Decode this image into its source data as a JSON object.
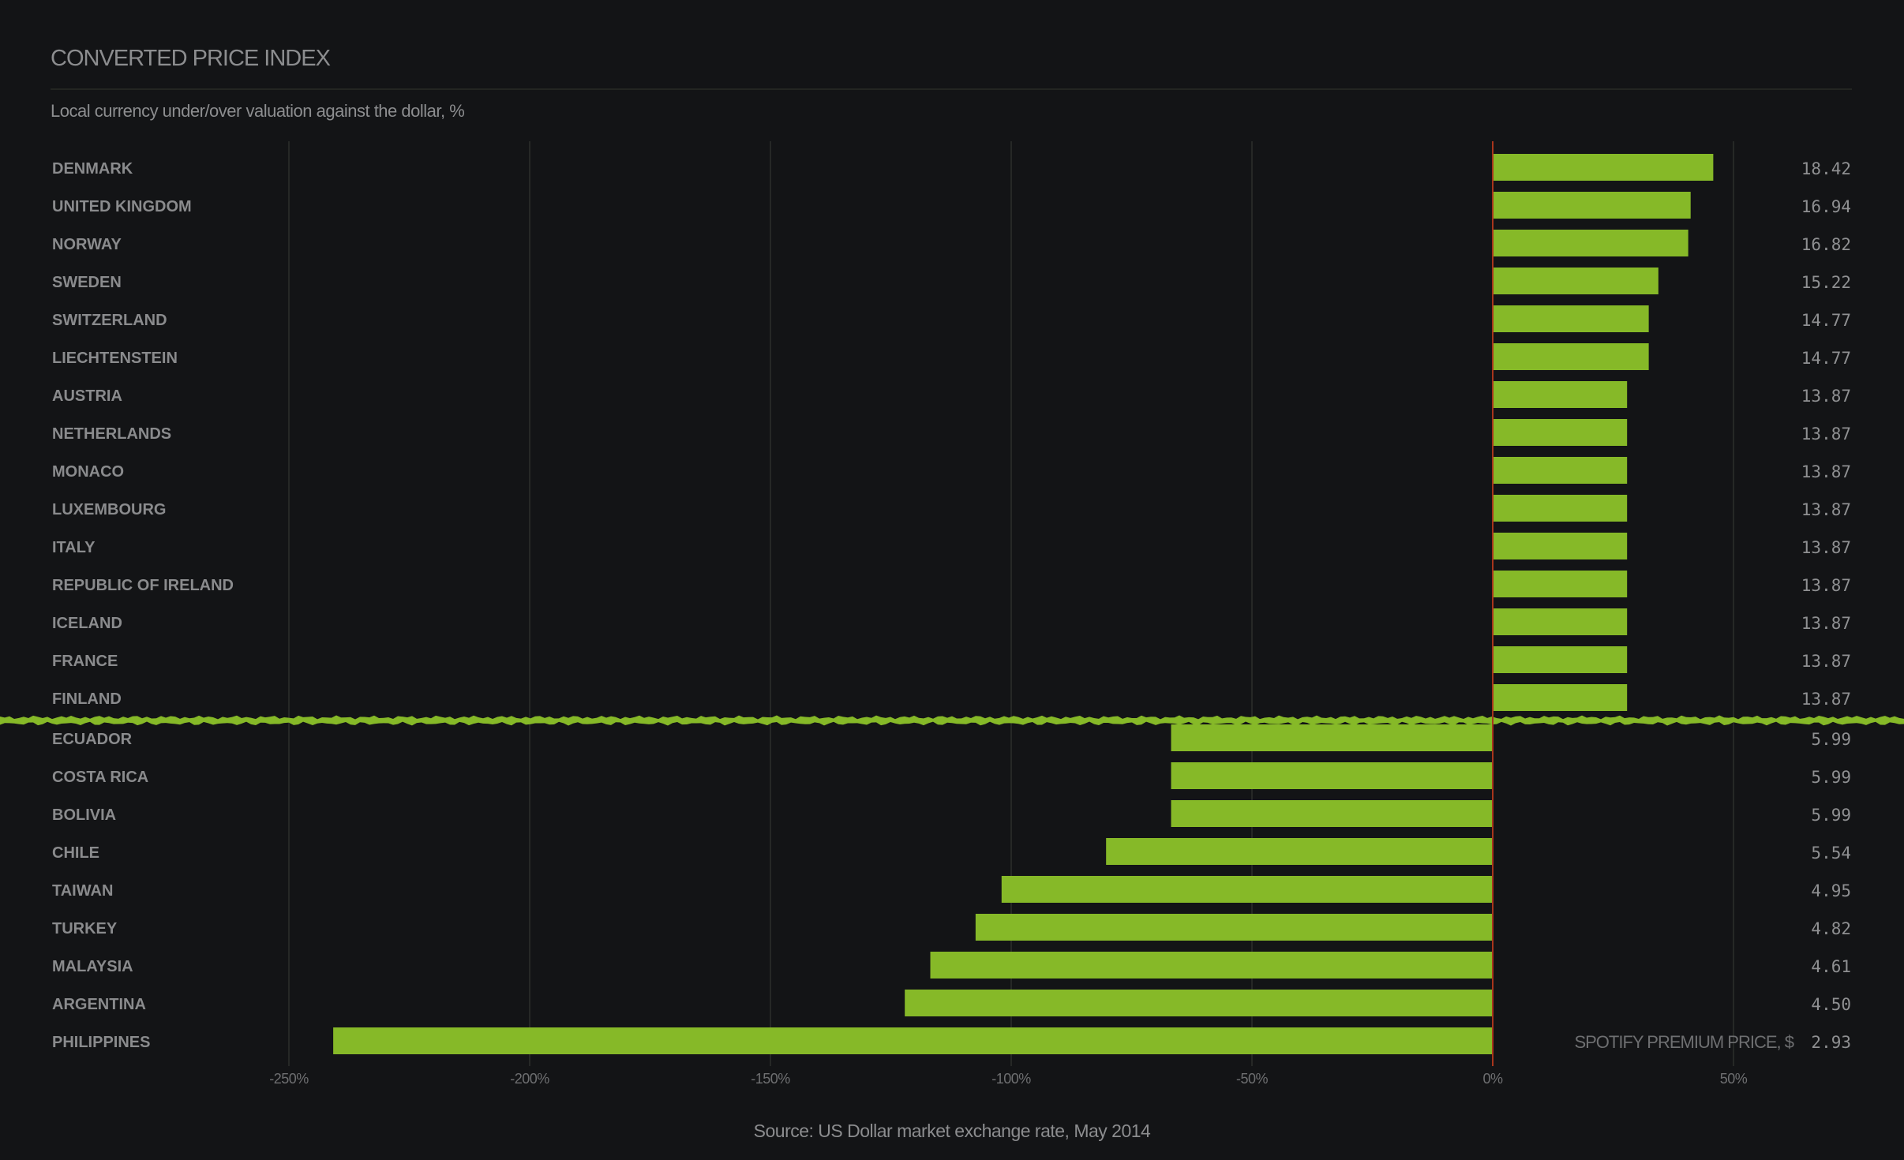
{
  "header": {
    "title": "CONVERTED PRICE INDEX",
    "subtitle": "Local currency under/over valuation against the dollar, %"
  },
  "footer": {
    "source": "Source: US Dollar market exchange rate, May 2014"
  },
  "colors": {
    "background": "#131416",
    "bar": "#86b928",
    "zero_line": "#a8351c",
    "gridline": "#262826",
    "label": "#8a8b8d",
    "break_line": "#86b928"
  },
  "chart_data": {
    "type": "bar",
    "orientation": "horizontal",
    "title": "CONVERTED PRICE INDEX",
    "subtitle": "Local currency under/over valuation against the dollar, %",
    "xlabel": "",
    "ylabel": "",
    "xlim": [
      -250,
      50
    ],
    "x_ticks": [
      -250,
      -200,
      -150,
      -100,
      -50,
      0,
      50
    ],
    "x_tick_labels": [
      "-250%",
      "-200%",
      "-150%",
      "-100%",
      "-50%",
      "0%",
      "50%"
    ],
    "grid": true,
    "value_column_label": "SPOTIFY PREMIUM PRICE, $",
    "axis_break_after_index": 14,
    "categories": [
      "DENMARK",
      "UNITED KINGDOM",
      "NORWAY",
      "SWEDEN",
      "SWITZERLAND",
      "LIECHTENSTEIN",
      "AUSTRIA",
      "NETHERLANDS",
      "MONACO",
      "LUXEMBOURG",
      "ITALY",
      "REPUBLIC OF IRELAND",
      "ICELAND",
      "FRANCE",
      "FINLAND",
      "ECUADOR",
      "COSTA RICA",
      "BOLIVIA",
      "CHILE",
      "TAIWAN",
      "TURKEY",
      "MALAYSIA",
      "ARGENTINA",
      "PHILIPPINES"
    ],
    "series": [
      {
        "name": "Valuation vs dollar, %",
        "values": [
          45.8,
          41.1,
          40.6,
          34.4,
          32.4,
          32.4,
          27.9,
          27.9,
          27.9,
          27.9,
          27.9,
          27.9,
          27.9,
          27.9,
          27.9,
          -66.8,
          -66.8,
          -66.8,
          -80.3,
          -102.0,
          -107.4,
          -116.8,
          -122.1,
          -240.8
        ]
      },
      {
        "name": "Spotify Premium price, $",
        "values": [
          "18.42",
          "16.94",
          "16.82",
          "15.22",
          "14.77",
          "14.77",
          "13.87",
          "13.87",
          "13.87",
          "13.87",
          "13.87",
          "13.87",
          "13.87",
          "13.87",
          "13.87",
          "5.99",
          "5.99",
          "5.99",
          "5.54",
          "4.95",
          "4.82",
          "4.61",
          "4.50",
          "2.93"
        ]
      }
    ]
  }
}
